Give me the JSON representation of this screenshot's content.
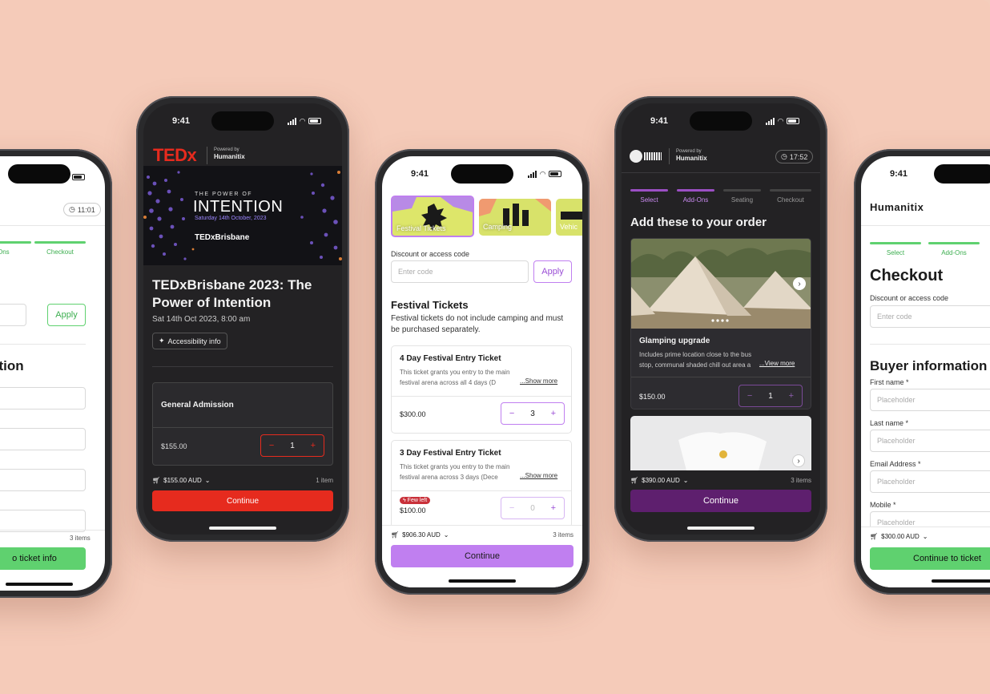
{
  "colors": {
    "background": "#f5cbb9",
    "humanitix_purple": "#c07ff0",
    "tedx_red": "#e62b1e",
    "green": "#5fd16f",
    "dark_purple": "#5e1f6e"
  },
  "status_time": "9:41",
  "phone1": {
    "timer": "11:01",
    "steps": [
      "Ons",
      "Checkout"
    ],
    "apply_label": "Apply",
    "section_title": "ation",
    "items_count": "3 items",
    "continue_label": "o ticket info"
  },
  "phone2": {
    "brand": "TEDx",
    "powered_by": "Powered by",
    "humanitix": "Humanitix",
    "banner": {
      "kicker": "THE POWER OF",
      "headline": "INTENTION",
      "date": "Saturday 14th October, 2023",
      "logo": "TEDxBrisbane"
    },
    "event_title": "TEDxBrisbane 2023: The Power of Intention",
    "event_date": "Sat 14th Oct 2023, 8:00 am",
    "accessibility": "Accessibility info",
    "ticket_name": "General Admission",
    "ticket_price": "$155.00",
    "qty": "1",
    "cart_total": "$155.00 AUD",
    "items_count": "1 item",
    "continue_label": "Continue"
  },
  "phone3": {
    "categories": [
      "Festival Tickets",
      "Camping",
      "Vehic"
    ],
    "discount_label": "Discount or access code",
    "discount_placeholder": "Enter code",
    "apply_label": "Apply",
    "section_title": "Festival Tickets",
    "section_desc": "Festival tickets do not include camping and must be purchased separately.",
    "tickets": [
      {
        "name": "4 Day Festival Entry Ticket",
        "desc": "This ticket grants you entry to the main festival arena across all 4 days (D",
        "more": "...Show more",
        "price": "$300.00",
        "qty": "3",
        "badge": ""
      },
      {
        "name": "3 Day Festival Entry Ticket",
        "desc": "This ticket grants you entry to the main festival arena across 3 days (Dece",
        "more": "...Show more",
        "price": "$100.00",
        "qty": "0",
        "badge": "Few left"
      }
    ],
    "cart_total": "$906.30 AUD",
    "items_count": "3 items",
    "continue_label": "Continue"
  },
  "phone4": {
    "powered_by": "Powered by",
    "humanitix": "Humanitix",
    "timer": "17:52",
    "steps": [
      "Select",
      "Add-Ons",
      "Seating",
      "Checkout"
    ],
    "title": "Add these to your order",
    "addon_name": "Glamping upgrade",
    "addon_desc": "Includes prime location close to the bus stop, communal shaded chill out area a",
    "view_more": "...View more",
    "addon_price": "$150.00",
    "qty": "1",
    "cart_total": "$390.00 AUD",
    "items_count": "3 items",
    "continue_label": "Continue"
  },
  "phone5": {
    "logo": "Humanitix",
    "steps": [
      "Select",
      "Add-Ons"
    ],
    "title": "Checkout",
    "discount_label": "Discount or access code",
    "discount_placeholder": "Enter code",
    "section_title": "Buyer information",
    "fields": [
      {
        "label": "First name *",
        "placeholder": "Placeholder"
      },
      {
        "label": "Last name *",
        "placeholder": "Placeholder"
      },
      {
        "label": "Email Address *",
        "placeholder": "Placeholder"
      },
      {
        "label": "Mobile *",
        "placeholder": "Placeholder"
      }
    ],
    "cart_total": "$300.00 AUD",
    "continue_label": "Continue to ticket"
  }
}
